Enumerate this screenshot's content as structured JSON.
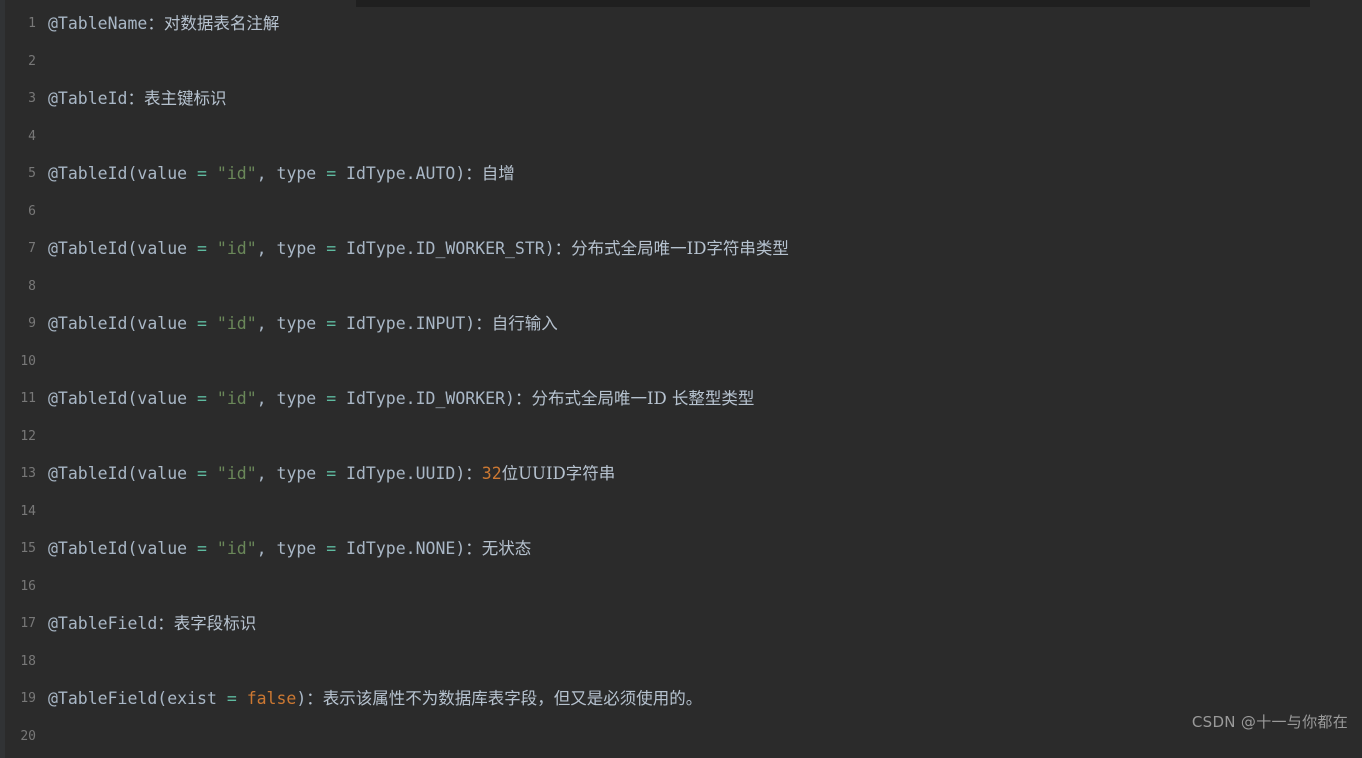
{
  "editor": {
    "background_color": "#2b2b2b",
    "gutter_color": "#787878",
    "default_text_color": "#a9b7c6",
    "string_color": "#6a8759",
    "operator_color": "#5fbba0",
    "number_color": "#cc7832",
    "keyword_color": "#cc7832",
    "chinese_text_color": "#b6c2cf"
  },
  "watermark": {
    "text": "CSDN @十一与你都在"
  },
  "lines": [
    {
      "number": "1",
      "tokens": [
        {
          "text": "@TableName",
          "type": "default"
        },
        {
          "text": "：",
          "type": "cn"
        },
        {
          "text": "对数据表名注解",
          "type": "cn"
        }
      ]
    },
    {
      "number": "2",
      "tokens": []
    },
    {
      "number": "3",
      "tokens": [
        {
          "text": "@TableId",
          "type": "default"
        },
        {
          "text": "：",
          "type": "cn"
        },
        {
          "text": "表主键标识",
          "type": "cn"
        }
      ]
    },
    {
      "number": "4",
      "tokens": []
    },
    {
      "number": "5",
      "tokens": [
        {
          "text": "@TableId(value ",
          "type": "default"
        },
        {
          "text": "=",
          "type": "op"
        },
        {
          "text": " ",
          "type": "default"
        },
        {
          "text": "\"id\"",
          "type": "string"
        },
        {
          "text": ", type ",
          "type": "default"
        },
        {
          "text": "=",
          "type": "op"
        },
        {
          "text": " IdType.AUTO)",
          "type": "default"
        },
        {
          "text": "：",
          "type": "cn"
        },
        {
          "text": "自增",
          "type": "cn"
        }
      ]
    },
    {
      "number": "6",
      "tokens": []
    },
    {
      "number": "7",
      "tokens": [
        {
          "text": "@TableId(value ",
          "type": "default"
        },
        {
          "text": "=",
          "type": "op"
        },
        {
          "text": " ",
          "type": "default"
        },
        {
          "text": "\"id\"",
          "type": "string"
        },
        {
          "text": ", type ",
          "type": "default"
        },
        {
          "text": "=",
          "type": "op"
        },
        {
          "text": " IdType.ID_WORKER_STR)",
          "type": "default"
        },
        {
          "text": "：",
          "type": "cn"
        },
        {
          "text": "分布式全局唯一ID字符串类型",
          "type": "cn"
        }
      ]
    },
    {
      "number": "8",
      "tokens": []
    },
    {
      "number": "9",
      "tokens": [
        {
          "text": "@TableId(value ",
          "type": "default"
        },
        {
          "text": "=",
          "type": "op"
        },
        {
          "text": " ",
          "type": "default"
        },
        {
          "text": "\"id\"",
          "type": "string"
        },
        {
          "text": ", type ",
          "type": "default"
        },
        {
          "text": "=",
          "type": "op"
        },
        {
          "text": " IdType.INPUT)",
          "type": "default"
        },
        {
          "text": "：",
          "type": "cn"
        },
        {
          "text": "自行输入",
          "type": "cn"
        }
      ]
    },
    {
      "number": "10",
      "tokens": []
    },
    {
      "number": "11",
      "tokens": [
        {
          "text": "@TableId(value ",
          "type": "default"
        },
        {
          "text": "=",
          "type": "op"
        },
        {
          "text": " ",
          "type": "default"
        },
        {
          "text": "\"id\"",
          "type": "string"
        },
        {
          "text": ", type ",
          "type": "default"
        },
        {
          "text": "=",
          "type": "op"
        },
        {
          "text": " IdType.ID_WORKER)",
          "type": "default"
        },
        {
          "text": "：",
          "type": "cn"
        },
        {
          "text": "分布式全局唯一ID 长整型类型",
          "type": "cn"
        }
      ]
    },
    {
      "number": "12",
      "tokens": []
    },
    {
      "number": "13",
      "tokens": [
        {
          "text": "@TableId(value ",
          "type": "default"
        },
        {
          "text": "=",
          "type": "op"
        },
        {
          "text": " ",
          "type": "default"
        },
        {
          "text": "\"id\"",
          "type": "string"
        },
        {
          "text": ", type ",
          "type": "default"
        },
        {
          "text": "=",
          "type": "op"
        },
        {
          "text": " IdType.UUID)",
          "type": "default"
        },
        {
          "text": "：",
          "type": "cn"
        },
        {
          "text": "32",
          "type": "number"
        },
        {
          "text": "位UUID字符串",
          "type": "cn"
        }
      ]
    },
    {
      "number": "14",
      "tokens": []
    },
    {
      "number": "15",
      "tokens": [
        {
          "text": "@TableId(value ",
          "type": "default"
        },
        {
          "text": "=",
          "type": "op"
        },
        {
          "text": " ",
          "type": "default"
        },
        {
          "text": "\"id\"",
          "type": "string"
        },
        {
          "text": ", type ",
          "type": "default"
        },
        {
          "text": "=",
          "type": "op"
        },
        {
          "text": " IdType.NONE)",
          "type": "default"
        },
        {
          "text": "：",
          "type": "cn"
        },
        {
          "text": "无状态",
          "type": "cn"
        }
      ]
    },
    {
      "number": "16",
      "tokens": []
    },
    {
      "number": "17",
      "tokens": [
        {
          "text": "@TableField",
          "type": "default"
        },
        {
          "text": "：",
          "type": "cn"
        },
        {
          "text": "表字段标识",
          "type": "cn"
        }
      ]
    },
    {
      "number": "18",
      "tokens": []
    },
    {
      "number": "19",
      "tokens": [
        {
          "text": "@TableField(exist ",
          "type": "default"
        },
        {
          "text": "=",
          "type": "op"
        },
        {
          "text": " ",
          "type": "default"
        },
        {
          "text": "false",
          "type": "keyword"
        },
        {
          "text": ")",
          "type": "default"
        },
        {
          "text": "：",
          "type": "cn"
        },
        {
          "text": "表示该属性不为数据库表字段，但又是必须使用的。",
          "type": "cn"
        }
      ]
    },
    {
      "number": "20",
      "tokens": []
    }
  ]
}
